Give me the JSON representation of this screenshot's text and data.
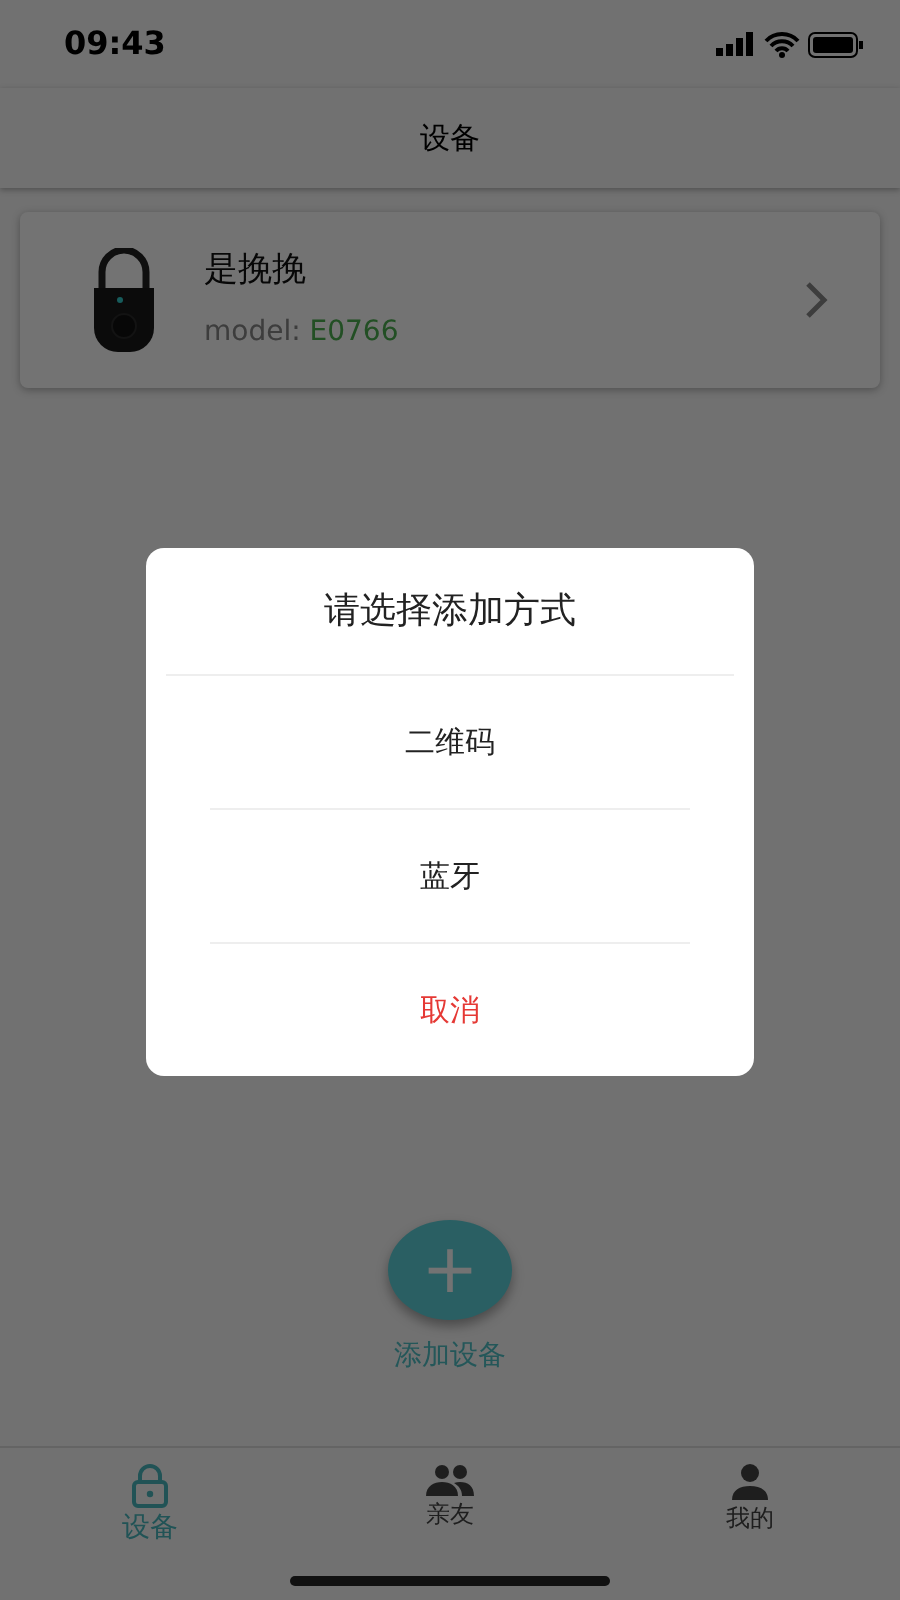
{
  "status_bar": {
    "time": "09:43"
  },
  "header": {
    "title": "设备"
  },
  "devices": [
    {
      "name": "是挽挽",
      "model_label": "model:",
      "model": "E0766"
    }
  ],
  "add_button": {
    "icon": "+",
    "label": "添加设备"
  },
  "tabs": [
    {
      "label": "设备",
      "kind": "lock",
      "selected": true
    },
    {
      "label": "亲友",
      "kind": "people",
      "selected": false
    },
    {
      "label": "我的",
      "kind": "person",
      "selected": false
    }
  ],
  "dialog": {
    "title": "请选择添加方式",
    "options": [
      {
        "label": "二维码",
        "kind": "option"
      },
      {
        "label": "蓝牙",
        "kind": "option"
      },
      {
        "label": "取消",
        "kind": "cancel"
      }
    ]
  }
}
